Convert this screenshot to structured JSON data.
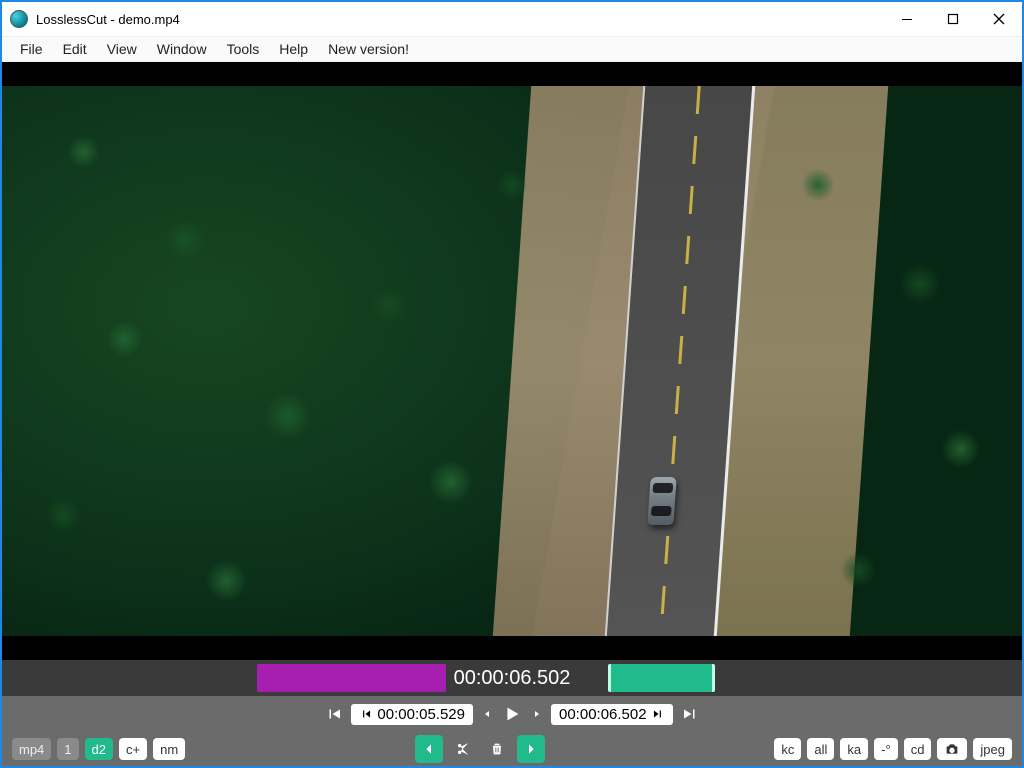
{
  "window": {
    "title": "LosslessCut - demo.mp4"
  },
  "menu": {
    "items": [
      "File",
      "Edit",
      "View",
      "Window",
      "Tools",
      "Help",
      "New version!"
    ]
  },
  "timeline": {
    "current_time": "00:00:06.502"
  },
  "transport": {
    "start_timecode": "00:00:05.529",
    "end_timecode": "00:00:06.502"
  },
  "bottom_left": {
    "format": "mp4",
    "seg_count": "1",
    "d_label": "d2",
    "c_label": "c+",
    "nm_label": "nm"
  },
  "bottom_right": {
    "kc": "kc",
    "all": "all",
    "ka": "ka",
    "rot": "-°",
    "cd": "cd",
    "jpeg": "jpeg"
  }
}
